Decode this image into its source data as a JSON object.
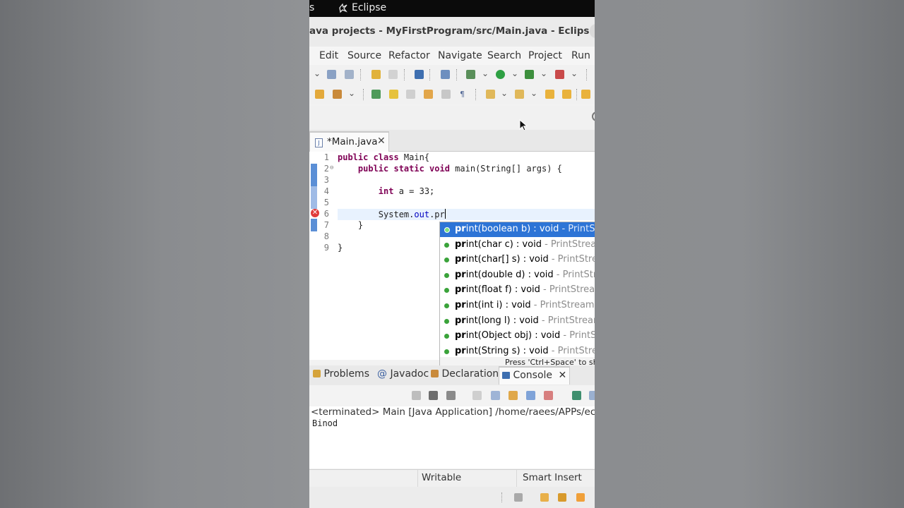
{
  "taskbar": {
    "partial_label": "s",
    "app_name": "Eclipse"
  },
  "window": {
    "title": "ava projects - MyFirstProgram/src/Main.java - Eclipse IDE"
  },
  "menu": [
    "Edit",
    "Source",
    "Refactor",
    "Navigate",
    "Search",
    "Project",
    "Run"
  ],
  "editor": {
    "tab_label": "*Main.java",
    "close_glyph": "✕",
    "lines": [
      {
        "num": "1",
        "tokens": [
          {
            "t": "public class ",
            "k": "kw"
          },
          {
            "t": "Main{",
            "k": ""
          }
        ]
      },
      {
        "num": "2",
        "tokens": [
          {
            "t": "    public static void ",
            "k": "kw"
          },
          {
            "t": "main(String[] args) {",
            "k": ""
          }
        ]
      },
      {
        "num": "3",
        "tokens": []
      },
      {
        "num": "4",
        "tokens": [
          {
            "t": "        int ",
            "k": "kw"
          },
          {
            "t": "a = 33;",
            "k": ""
          }
        ]
      },
      {
        "num": "5",
        "tokens": []
      },
      {
        "num": "6",
        "tokens": [
          {
            "t": "        System.",
            "k": ""
          },
          {
            "t": "out",
            "k": "fld"
          },
          {
            "t": ".pr",
            "k": ""
          }
        ]
      },
      {
        "num": "7",
        "tokens": [
          {
            "t": "    }",
            "k": ""
          }
        ]
      },
      {
        "num": "8",
        "tokens": []
      },
      {
        "num": "9",
        "tokens": [
          {
            "t": "}",
            "k": ""
          }
        ]
      }
    ],
    "error_line": "6"
  },
  "content_assist": {
    "proposals": [
      {
        "match": "pr",
        "rest": "int(boolean b) : void",
        "tail": " - PrintStream"
      },
      {
        "match": "pr",
        "rest": "int(char c) : void",
        "tail": " - PrintStream"
      },
      {
        "match": "pr",
        "rest": "int(char[] s) : void",
        "tail": " - PrintStream"
      },
      {
        "match": "pr",
        "rest": "int(double d) : void",
        "tail": " - PrintStream"
      },
      {
        "match": "pr",
        "rest": "int(float f) : void",
        "tail": " - PrintStream"
      },
      {
        "match": "pr",
        "rest": "int(int i) : void",
        "tail": " - PrintStream"
      },
      {
        "match": "pr",
        "rest": "int(long l) : void",
        "tail": " - PrintStream"
      },
      {
        "match": "pr",
        "rest": "int(Object obj) : void",
        "tail": " - PrintStream"
      },
      {
        "match": "pr",
        "rest": "int(String s) : void",
        "tail": " - PrintStream"
      }
    ],
    "selected_index": 0,
    "hint": "Press 'Ctrl+Space' to show Template Proposals"
  },
  "bottom_tabs": {
    "problems": "Problems",
    "javadoc": "Javadoc",
    "declaration": "Declaration",
    "console": "Console",
    "javadoc_glyph": "@",
    "close_glyph": "✕"
  },
  "console": {
    "header": "<terminated> Main [Java Application] /home/raees/APPs/eclipse",
    "output": "Binod"
  },
  "status": {
    "writable": "Writable",
    "insert_mode": "Smart Insert"
  }
}
